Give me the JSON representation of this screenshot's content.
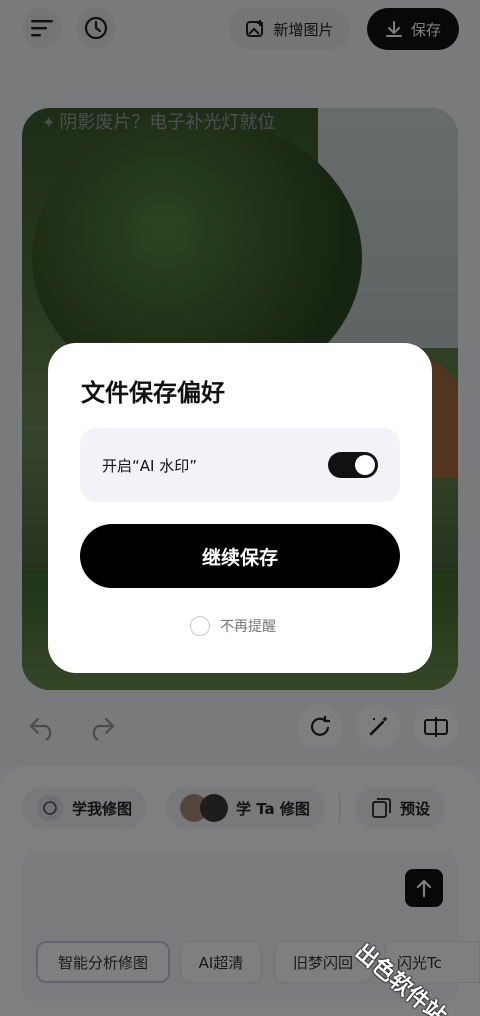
{
  "header": {
    "add_image_label": "新增图片",
    "save_label": "保存"
  },
  "dialog": {
    "title": "文件保存偏好",
    "watermark_setting_label": "开启“AI 水印”",
    "watermark_enabled": true,
    "continue_button": "继续保存",
    "no_remind_label": "不再提醒"
  },
  "bottom": {
    "chips": [
      "学我修图",
      "学 Ta 修图",
      "预设"
    ],
    "prompt_placeholder": "阴影废片？电子补光灯就位",
    "tags": [
      "智能分析修图",
      "AI超清",
      "旧梦闪回",
      "闪光Tc"
    ]
  },
  "watermark_text": "出色软件站",
  "icons": {
    "menu": "menu-icon",
    "history": "history-icon",
    "add_image": "add-image-icon",
    "download": "download-icon",
    "undo": "undo-icon",
    "redo": "redo-icon",
    "rotate": "rotate-icon",
    "magic": "magic-wand-icon",
    "compare": "compare-icon",
    "sparkle": "sparkle-icon",
    "send": "arrow-up-icon"
  }
}
